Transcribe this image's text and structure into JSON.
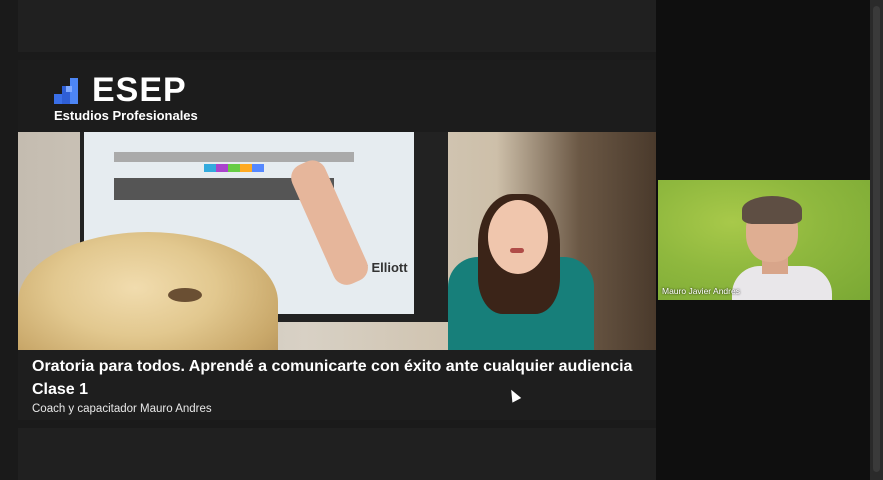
{
  "brand": {
    "name": "ESEP",
    "subtitle": "Estudios Profesionales"
  },
  "presentation": {
    "title": "Oratoria para todos. Aprendé a comunicarte con éxito ante cualquier audiencia",
    "class_label": "Clase 1",
    "coach": "Coach y capacitador Mauro Andres",
    "screen_text": "Kay Elliott"
  },
  "participants": [
    {
      "name": "Mauro Javier Andres"
    }
  ],
  "colors": {
    "background": "#1a1a1a",
    "brand_blue": "#3a6fe8",
    "caption_bg": "#1e1e1e"
  },
  "icons": [
    "esep-logo-icon",
    "mouse-pointer-icon"
  ]
}
